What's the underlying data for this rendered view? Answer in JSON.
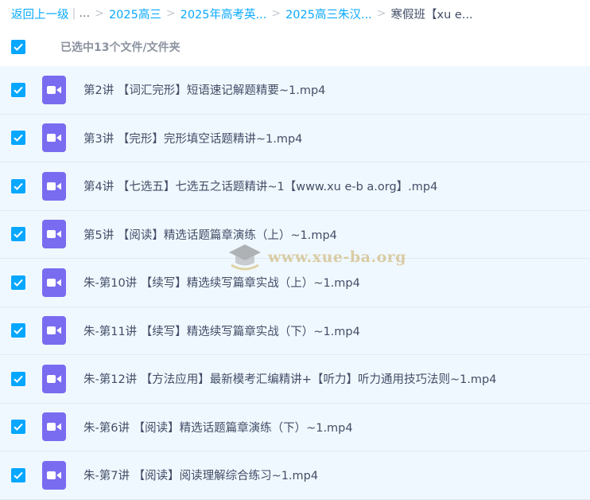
{
  "breadcrumb": {
    "back": "返回上一级",
    "ellipsis": "...",
    "items": [
      "2025高三",
      "2025年高考英...",
      "2025高三朱汉..."
    ],
    "current": "寒假班【xu e..."
  },
  "selection": {
    "label": "已选中13个文件/文件夹"
  },
  "files": [
    {
      "name": "第2讲 【词汇完形】短语速记解题精要~1.mp4"
    },
    {
      "name": "第3讲 【完形】完形填空话题精讲~1.mp4"
    },
    {
      "name": "第4讲 【七选五】七选五之话题精讲~1【www.xu e-b a.org】.mp4"
    },
    {
      "name": "第5讲 【阅读】精选话题篇章演练（上）~1.mp4"
    },
    {
      "name": "朱-第10讲 【续写】精选续写篇章实战（上）~1.mp4"
    },
    {
      "name": "朱-第11讲 【续写】精选续写篇章实战（下）~1.mp4"
    },
    {
      "name": "朱-第12讲 【方法应用】最新模考汇编精讲+【听力】听力通用技巧法则~1.mp4"
    },
    {
      "name": "朱-第6讲 【阅读】精选话题篇章演练（下）~1.mp4"
    },
    {
      "name": "朱-第7讲 【阅读】阅读理解综合练习~1.mp4"
    }
  ],
  "icons": {
    "checkbox": "checkbox-checked-icon",
    "file": "video-file-icon"
  },
  "colors": {
    "accent": "#06a7ff",
    "link": "#09aaff",
    "video_icon": "#7a6cf0",
    "row_bg": "#f0f8ff"
  },
  "watermark": "www.xue-ba.org"
}
